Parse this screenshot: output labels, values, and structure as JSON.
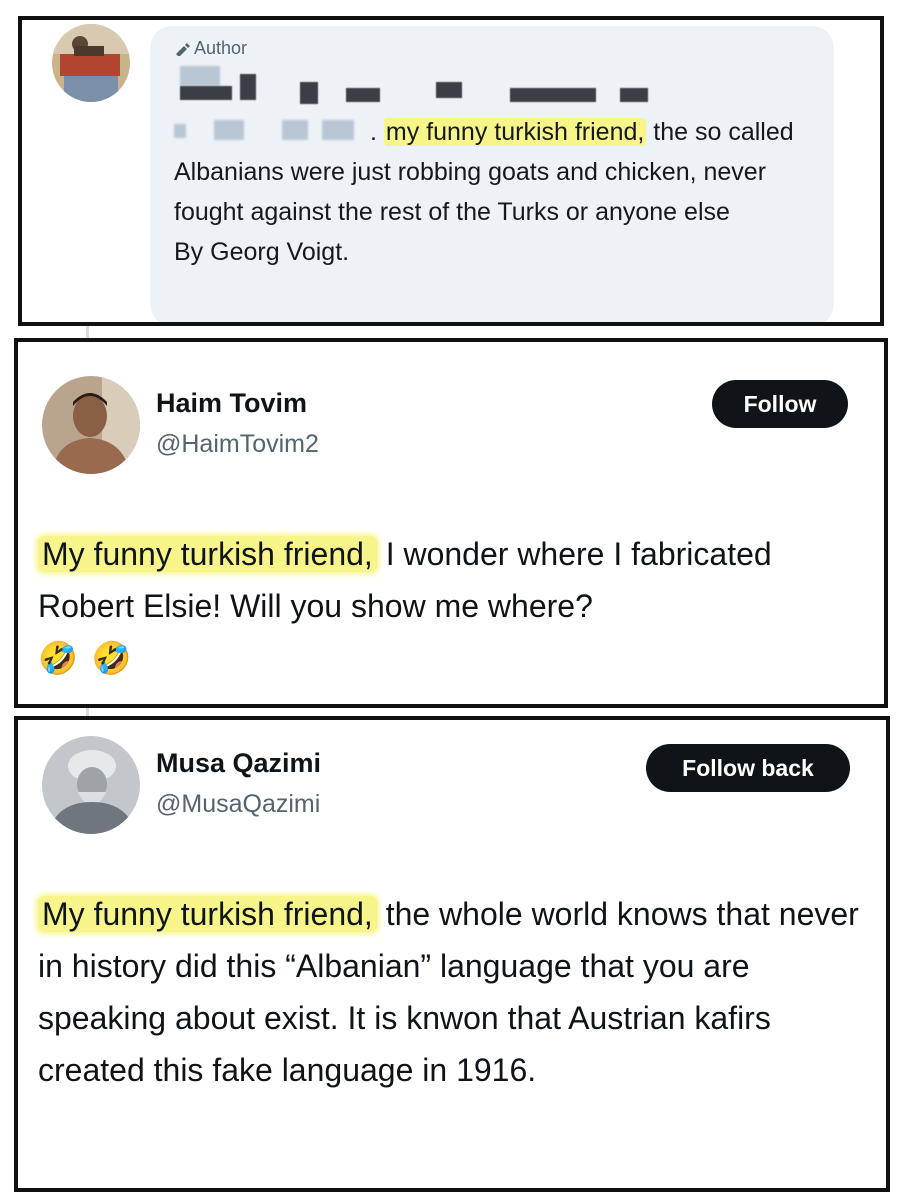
{
  "reply": {
    "author_tag": "Author",
    "highlight": "my funny turkish friend,",
    "lead": ".",
    "text_after": " the so called Albanians were just robbing goats and chicken, never fought against the rest of the Turks or anyone else",
    "signature": "By Georg Voigt."
  },
  "post1": {
    "name": "Haim Tovim",
    "handle": "@HaimTovim2",
    "follow_label": "Follow",
    "highlight": "My funny turkish friend,",
    "text": " I wonder where I fabricated Robert Elsie! Will you show me where?",
    "emojis": [
      "🤣",
      "🤣"
    ]
  },
  "post2": {
    "name": "Musa Qazimi",
    "handle": "@MusaQazimi",
    "follow_label": "Follow back",
    "highlight": "My funny turkish friend,",
    "text": " the whole world knows that never in history did this “Albanian” language that you are speaking about exist. It is knwon that Austrian kafirs created this fake language in 1916."
  },
  "colors": {
    "highlight": "#f7f58a",
    "button_bg": "#0f1419",
    "bubble_bg": "#edf2f7",
    "muted": "#536471"
  },
  "icons": {
    "author": "pen-icon"
  }
}
